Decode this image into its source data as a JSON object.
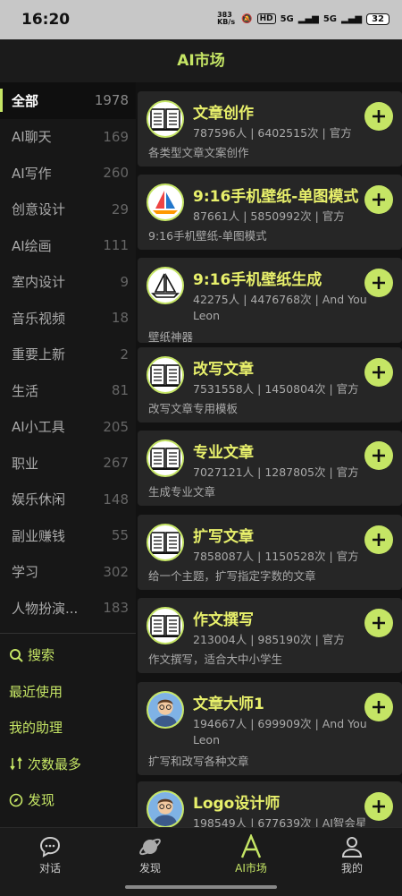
{
  "status": {
    "time": "16:20",
    "speed": "383 KB/s",
    "hd": "HD",
    "sig1": "5G",
    "sig2": "5G",
    "battery": "32"
  },
  "header": {
    "title": "AI市场"
  },
  "sidebar": {
    "categories": [
      {
        "label": "全部",
        "count": "1978"
      },
      {
        "label": "AI聊天",
        "count": "169"
      },
      {
        "label": "AI写作",
        "count": "260"
      },
      {
        "label": "创意设计",
        "count": "29"
      },
      {
        "label": "AI绘画",
        "count": "111"
      },
      {
        "label": "室内设计",
        "count": "9"
      },
      {
        "label": "音乐视频",
        "count": "18"
      },
      {
        "label": "重要上新",
        "count": "2"
      },
      {
        "label": "生活",
        "count": "81"
      },
      {
        "label": "AI小工具",
        "count": "205"
      },
      {
        "label": "职业",
        "count": "267"
      },
      {
        "label": "娱乐休闲",
        "count": "148"
      },
      {
        "label": "副业赚钱",
        "count": "55"
      },
      {
        "label": "学习",
        "count": "302"
      },
      {
        "label": "人物扮演...",
        "count": "183"
      }
    ],
    "links": [
      {
        "label": "搜索",
        "icon": "search-icon"
      },
      {
        "label": "最近使用"
      },
      {
        "label": "我的助理"
      },
      {
        "label": "次数最多",
        "icon": "sort-icon"
      },
      {
        "label": "发现",
        "icon": "compass-icon"
      }
    ]
  },
  "cards": [
    {
      "name": "文章创作",
      "meta": "787596人 | 6402515次 | 官方",
      "desc": "各类型文章文案创作",
      "avatar": "book-icon"
    },
    {
      "name": "9:16手机壁纸-单图模式",
      "meta": "87661人 | 5850992次 | 官方",
      "desc": "9:16手机壁纸-单图模式",
      "avatar": "sailboat-icon"
    },
    {
      "name": "9:16手机壁纸生成",
      "meta": "42275人 | 4476768次 | And You Leon",
      "desc": "壁纸神器",
      "avatar": "sailboat-outline-icon"
    },
    {
      "name": "改写文章",
      "meta": "7531558人 | 1450804次 | 官方",
      "desc": "改写文章专用模板",
      "avatar": "book-icon"
    },
    {
      "name": "专业文章",
      "meta": "7027121人 | 1287805次 | 官方",
      "desc": "生成专业文章",
      "avatar": "book-icon"
    },
    {
      "name": "扩写文章",
      "meta": "7858087人 | 1150528次 | 官方",
      "desc": "给一个主题，扩写指定字数的文章",
      "avatar": "book-icon"
    },
    {
      "name": "作文撰写",
      "meta": "213004人 | 985190次 | 官方",
      "desc": "作文撰写，适合大中小学生",
      "avatar": "book-icon"
    },
    {
      "name": "文章大师1",
      "meta": "194667人 | 699909次 | And You Leon",
      "desc": "扩写和改写各种文章",
      "avatar": "person-avatar-icon"
    },
    {
      "name": "Logo设计师",
      "meta": "198549人 | 677639次 | AI智会星",
      "desc": "",
      "avatar": "person-avatar-icon"
    }
  ],
  "tabs": [
    {
      "label": "对话",
      "icon": "chat-icon"
    },
    {
      "label": "发现",
      "icon": "planet-icon"
    },
    {
      "label": "AI市场",
      "icon": "letter-a-icon"
    },
    {
      "label": "我的",
      "icon": "person-icon"
    }
  ],
  "colors": {
    "accent": "#c5e565",
    "title": "#e8f06b"
  }
}
